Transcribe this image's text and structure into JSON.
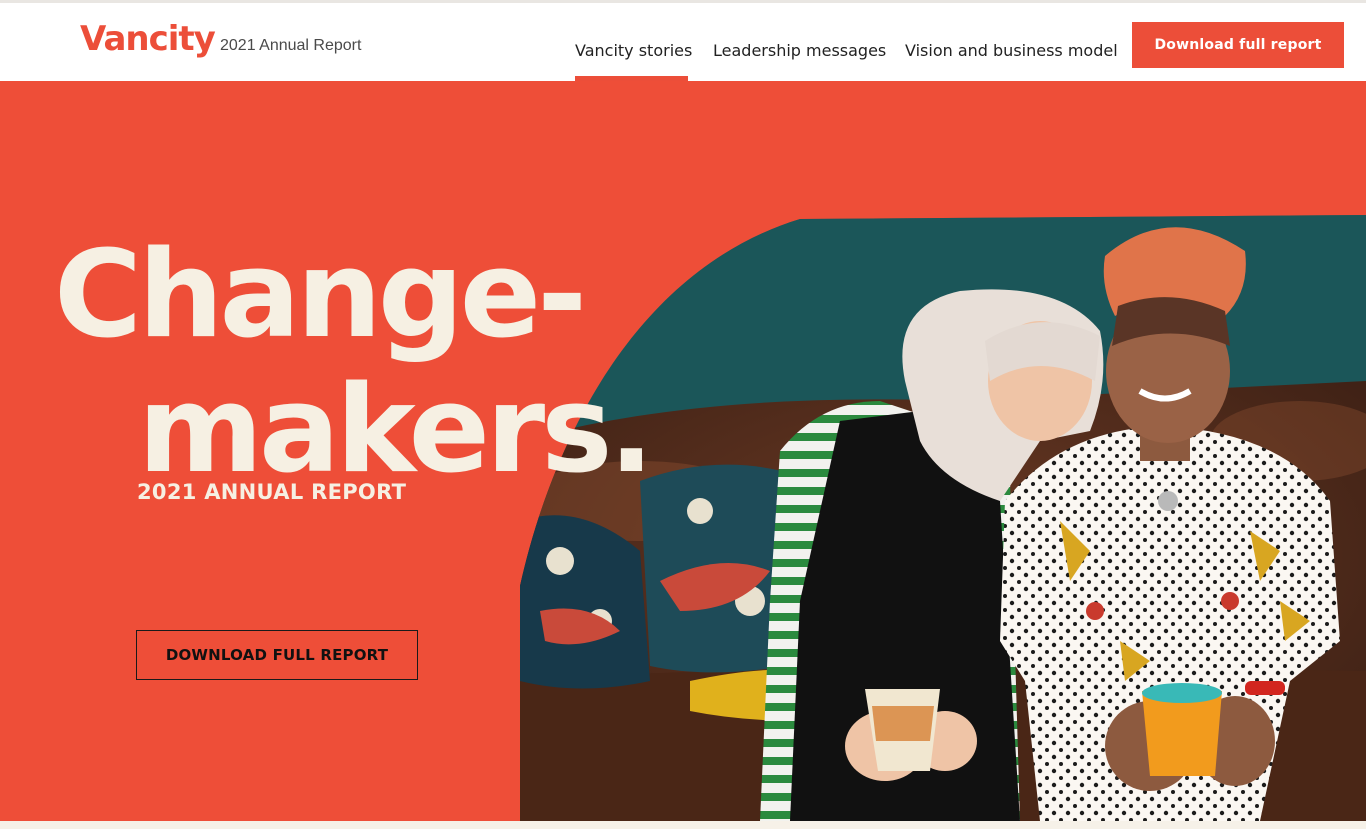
{
  "header": {
    "logo": "Vancity",
    "subtitle": "2021 Annual Report",
    "nav": [
      {
        "label": "Vancity stories",
        "active": true
      },
      {
        "label": "Leadership messages",
        "active": false
      },
      {
        "label": "Vision and business model",
        "active": false
      }
    ],
    "download_button": "Download full report"
  },
  "hero": {
    "headline_line1": "Change-",
    "headline_line2": "makers.",
    "tagline": "2021 ANNUAL REPORT",
    "download_button": "DOWNLOAD FULL REPORT"
  },
  "colors": {
    "brand": "#ec4e39",
    "hero_background": "#ee4e38",
    "headline": "#f6f0e3",
    "photo_wall": "#1d5a5c"
  }
}
